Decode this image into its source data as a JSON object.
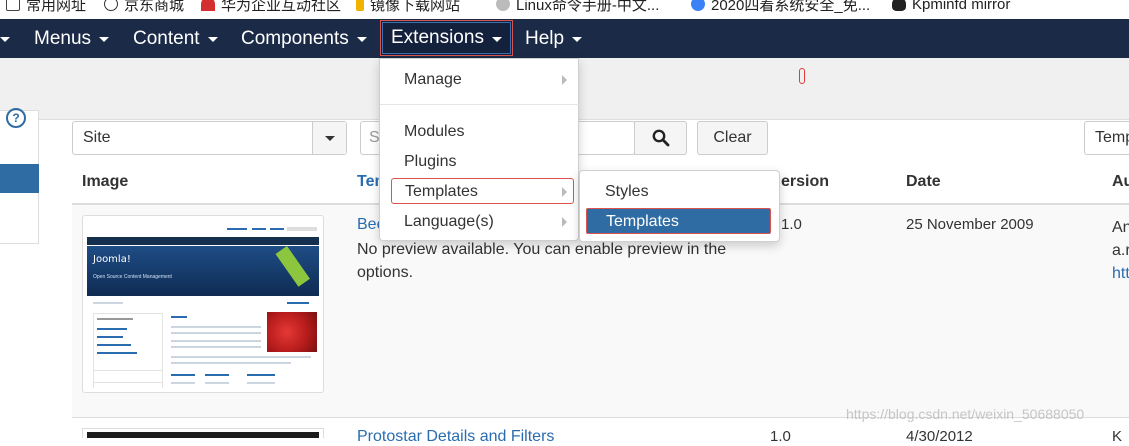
{
  "bookmarks": [
    {
      "label": "常用网址",
      "icon": "checkbox-icon",
      "color": "#444444"
    },
    {
      "label": "京东商城",
      "icon": "globe-icon",
      "color": "#333333"
    },
    {
      "label": "华为企业互动社区",
      "icon": "huawei-icon",
      "color": "#d32f2f"
    },
    {
      "label": "镜像下载网站",
      "icon": "bookmark-icon",
      "color": "#f0b400"
    },
    {
      "label": "Linux命令手册-中文...",
      "icon": "spark-icon",
      "color": "#888888"
    },
    {
      "label": "2020四着系统安全_免...",
      "icon": "swirl-icon",
      "color": "#3b82f6"
    },
    {
      "label": "Kpminfd mirror",
      "icon": "penguin-icon",
      "color": "#222222"
    }
  ],
  "navbar": {
    "items": [
      "Menus",
      "Content",
      "Components",
      "Extensions",
      "Help"
    ],
    "bg_color": "#1b2a47"
  },
  "extensions_menu": {
    "manage": "Manage",
    "modules": "Modules",
    "plugins": "Plugins",
    "templates": "Templates",
    "languages": "Language(s)"
  },
  "templates_submenu": {
    "styles": "Styles",
    "templates": "Templates",
    "highlight_color": "#2f6ca3"
  },
  "filters": {
    "site_value": "Site",
    "search_placeholder": "S",
    "clear_label": "Clear",
    "sort_value": "Temp"
  },
  "table": {
    "headers": {
      "image": "Image",
      "template": "Tem",
      "version": "ersion",
      "date": "Date",
      "author": "Au"
    },
    "rows": [
      {
        "name": "Bee",
        "description": "No preview available. You can enable preview in the options.",
        "version": "1.0",
        "date": "25 November 2009",
        "author_line1": "An",
        "author_line2": "a.r",
        "author_link": "htt"
      },
      {
        "name": "Protostar Details and Filters",
        "version": "1.0",
        "date": "4/30/2012",
        "author": "K"
      }
    ]
  },
  "thumbnail": {
    "logo_text": "Joomla!",
    "tagline": "Open Source Content Management"
  },
  "watermark": "https://blog.csdn.net/weixin_50688050"
}
